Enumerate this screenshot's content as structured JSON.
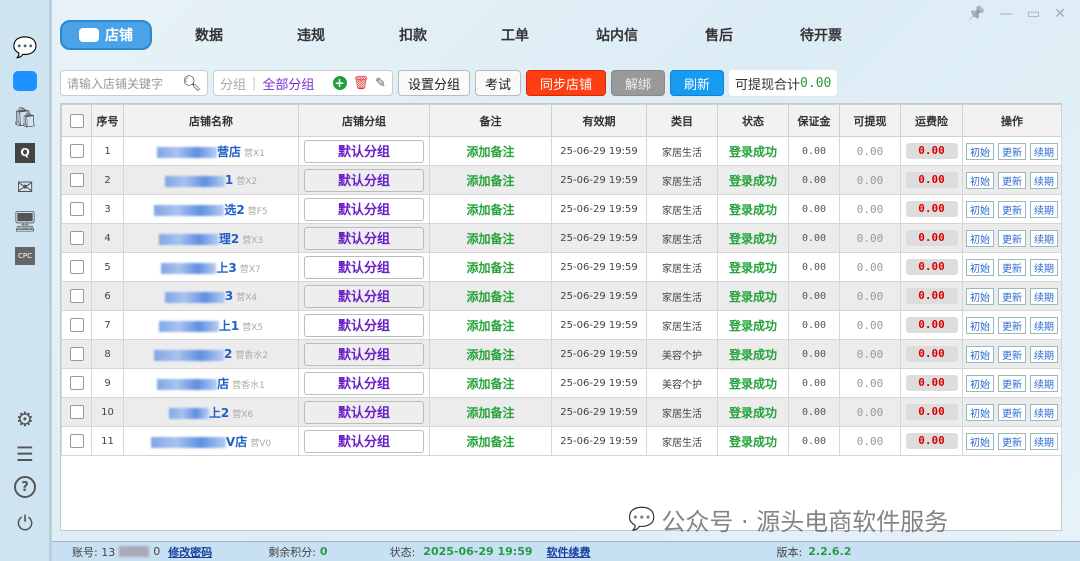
{
  "window": {
    "pin": "📌",
    "min": "—",
    "max": "▭",
    "close": "✕"
  },
  "sidebar": {
    "items": [
      "chat-icon",
      "shop-icon",
      "product-search-icon",
      "qa-icon",
      "mail-icon",
      "monitor-icon",
      "cpc-icon",
      "settings-icon",
      "log-icon",
      "help-icon",
      "power-icon"
    ],
    "cpc_label": "CPC"
  },
  "tabs": [
    "店铺",
    "数据",
    "违规",
    "扣款",
    "工单",
    "站内信",
    "售后",
    "待开票"
  ],
  "toolbar": {
    "search_placeholder": "请输入店铺关键字",
    "group_label": "分组",
    "group_value": "全部分组",
    "set_group": "设置分组",
    "exam": "考试",
    "sync": "同步店铺",
    "unbind": "解绑",
    "refresh": "刷新",
    "total_label": "可提现合计",
    "total_value": "0.00"
  },
  "table": {
    "headers": [
      "序号",
      "店铺名称",
      "店铺分组",
      "备注",
      "有效期",
      "类目",
      "状态",
      "保证金",
      "可提现",
      "运费险",
      "操作"
    ],
    "rows": [
      {
        "no": "1",
        "name": "营店",
        "sub": "营X1",
        "group": "默认分组",
        "note": "添加备注",
        "expiry": "25-06-29 19:59",
        "category": "家居生活",
        "status": "登录成功",
        "deposit": "0.00",
        "withdrawable": "0.00",
        "insurance": "0.00"
      },
      {
        "no": "2",
        "name": "1",
        "sub": "营X2",
        "group": "默认分组",
        "note": "添加备注",
        "expiry": "25-06-29 19:59",
        "category": "家居生活",
        "status": "登录成功",
        "deposit": "0.00",
        "withdrawable": "0.00",
        "insurance": "0.00"
      },
      {
        "no": "3",
        "name": "选2",
        "sub": "营F5",
        "group": "默认分组",
        "note": "添加备注",
        "expiry": "25-06-29 19:59",
        "category": "家居生活",
        "status": "登录成功",
        "deposit": "0.00",
        "withdrawable": "0.00",
        "insurance": "0.00"
      },
      {
        "no": "4",
        "name": "理2",
        "sub": "营X3",
        "group": "默认分组",
        "note": "添加备注",
        "expiry": "25-06-29 19:59",
        "category": "家居生活",
        "status": "登录成功",
        "deposit": "0.00",
        "withdrawable": "0.00",
        "insurance": "0.00"
      },
      {
        "no": "5",
        "name": "上3",
        "sub": "营X7",
        "group": "默认分组",
        "note": "添加备注",
        "expiry": "25-06-29 19:59",
        "category": "家居生活",
        "status": "登录成功",
        "deposit": "0.00",
        "withdrawable": "0.00",
        "insurance": "0.00"
      },
      {
        "no": "6",
        "name": "3",
        "sub": "营X4",
        "group": "默认分组",
        "note": "添加备注",
        "expiry": "25-06-29 19:59",
        "category": "家居生活",
        "status": "登录成功",
        "deposit": "0.00",
        "withdrawable": "0.00",
        "insurance": "0.00"
      },
      {
        "no": "7",
        "name": "上1",
        "sub": "营X5",
        "group": "默认分组",
        "note": "添加备注",
        "expiry": "25-06-29 19:59",
        "category": "家居生活",
        "status": "登录成功",
        "deposit": "0.00",
        "withdrawable": "0.00",
        "insurance": "0.00"
      },
      {
        "no": "8",
        "name": "2",
        "sub": "营香水2",
        "group": "默认分组",
        "note": "添加备注",
        "expiry": "25-06-29 19:59",
        "category": "美容个护",
        "status": "登录成功",
        "deposit": "0.00",
        "withdrawable": "0.00",
        "insurance": "0.00"
      },
      {
        "no": "9",
        "name": "店",
        "sub": "营香水1",
        "group": "默认分组",
        "note": "添加备注",
        "expiry": "25-06-29 19:59",
        "category": "美容个护",
        "status": "登录成功",
        "deposit": "0.00",
        "withdrawable": "0.00",
        "insurance": "0.00"
      },
      {
        "no": "10",
        "name": "上2",
        "sub": "营X6",
        "group": "默认分组",
        "note": "添加备注",
        "expiry": "25-06-29 19:59",
        "category": "家居生活",
        "status": "登录成功",
        "deposit": "0.00",
        "withdrawable": "0.00",
        "insurance": "0.00"
      },
      {
        "no": "11",
        "name": "V店",
        "sub": "营V0",
        "group": "默认分组",
        "note": "添加备注",
        "expiry": "25-06-29 19:59",
        "category": "家居生活",
        "status": "登录成功",
        "deposit": "0.00",
        "withdrawable": "0.00",
        "insurance": "0.00"
      }
    ],
    "ops": [
      "初始",
      "更新",
      "续期"
    ]
  },
  "status": {
    "account_label": "账号: 13",
    "account_end": "0",
    "change_pwd": "修改密码",
    "points_label": "剩余积分:",
    "points": "0",
    "state_label": "状态:",
    "state": "2025-06-29 19:59",
    "renew": "软件续费",
    "version_label": "版本:",
    "version": "2.2.6.2"
  },
  "watermark": "公众号 · 源头电商软件服务"
}
